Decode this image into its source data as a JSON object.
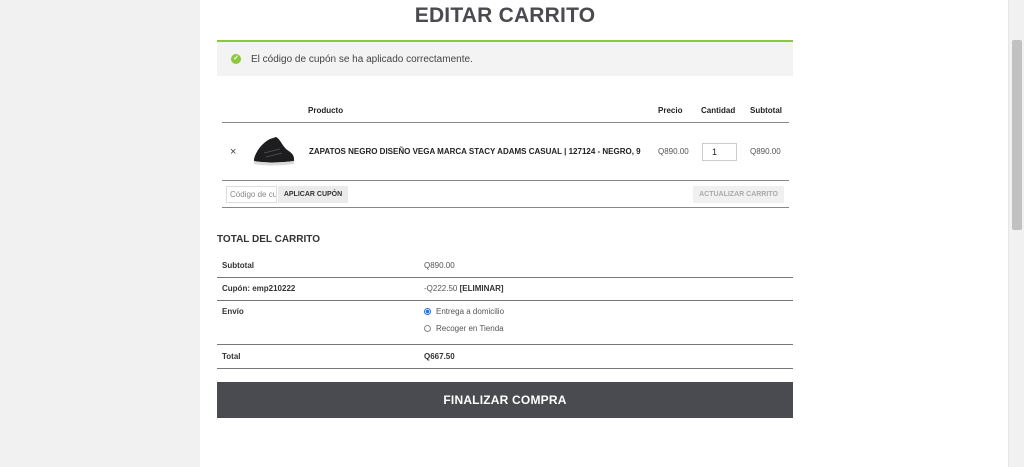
{
  "page_title": "EDITAR CARRITO",
  "notice": {
    "message": "El código de cupón se ha aplicado correctamente."
  },
  "cart_table": {
    "headers": {
      "product": "Producto",
      "price": "Precio",
      "quantity": "Cantidad",
      "subtotal": "Subtotal"
    },
    "item": {
      "remove": "×",
      "name": "ZAPATOS NEGRO DISEÑO VEGA MARCA STACY ADAMS CASUAL | 127124 - NEGRO, 9",
      "price": "Q890.00",
      "quantity": "1",
      "subtotal": "Q890.00"
    },
    "coupon_placeholder": "Código de cupón",
    "apply_coupon_label": "APLICAR CUPÓN",
    "update_cart_label": "ACTUALIZAR CARRITO"
  },
  "totals": {
    "title": "TOTAL DEL CARRITO",
    "subtotal_label": "Subtotal",
    "subtotal_value": "Q890.00",
    "coupon_label": "Cupón: emp210222",
    "coupon_value": "-Q222.50",
    "coupon_remove": "[ELIMINAR]",
    "shipping_label": "Envío",
    "shipping_options": [
      "Entrega a domicilio",
      "Recoger en Tienda"
    ],
    "shipping_selected": "Entrega a domicilio",
    "total_label": "Total",
    "total_value": "Q667.50"
  },
  "checkout_label": "FINALIZAR COMPRA",
  "colors": {
    "accent": "#8dc63f",
    "checkout_bg": "#4a4b50",
    "radio": "#1a73e8"
  }
}
